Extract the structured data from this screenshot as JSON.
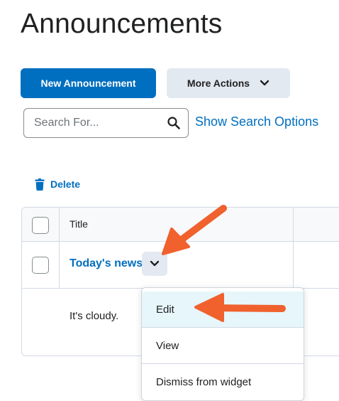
{
  "page": {
    "title": "Announcements"
  },
  "toolbar": {
    "new_label": "New Announcement",
    "more_label": "More Actions"
  },
  "search": {
    "placeholder": "Search For...",
    "value": "",
    "options_link": "Show Search Options"
  },
  "bulk_actions": {
    "delete_label": "Delete"
  },
  "table": {
    "header": {
      "title": "Title"
    },
    "rows": [
      {
        "title": "Today's news",
        "body": "It's cloudy."
      }
    ]
  },
  "context_menu": {
    "items": [
      "Edit",
      "View",
      "Dismiss from widget"
    ],
    "selected": "Edit"
  },
  "colors": {
    "primary": "#006fbf",
    "secondary_button": "#e3e9f1",
    "annotation_arrow": "#f0612d",
    "menu_highlight": "#e6f6fb"
  },
  "icons": [
    "search-icon",
    "trash-icon",
    "chevron-down-icon"
  ]
}
